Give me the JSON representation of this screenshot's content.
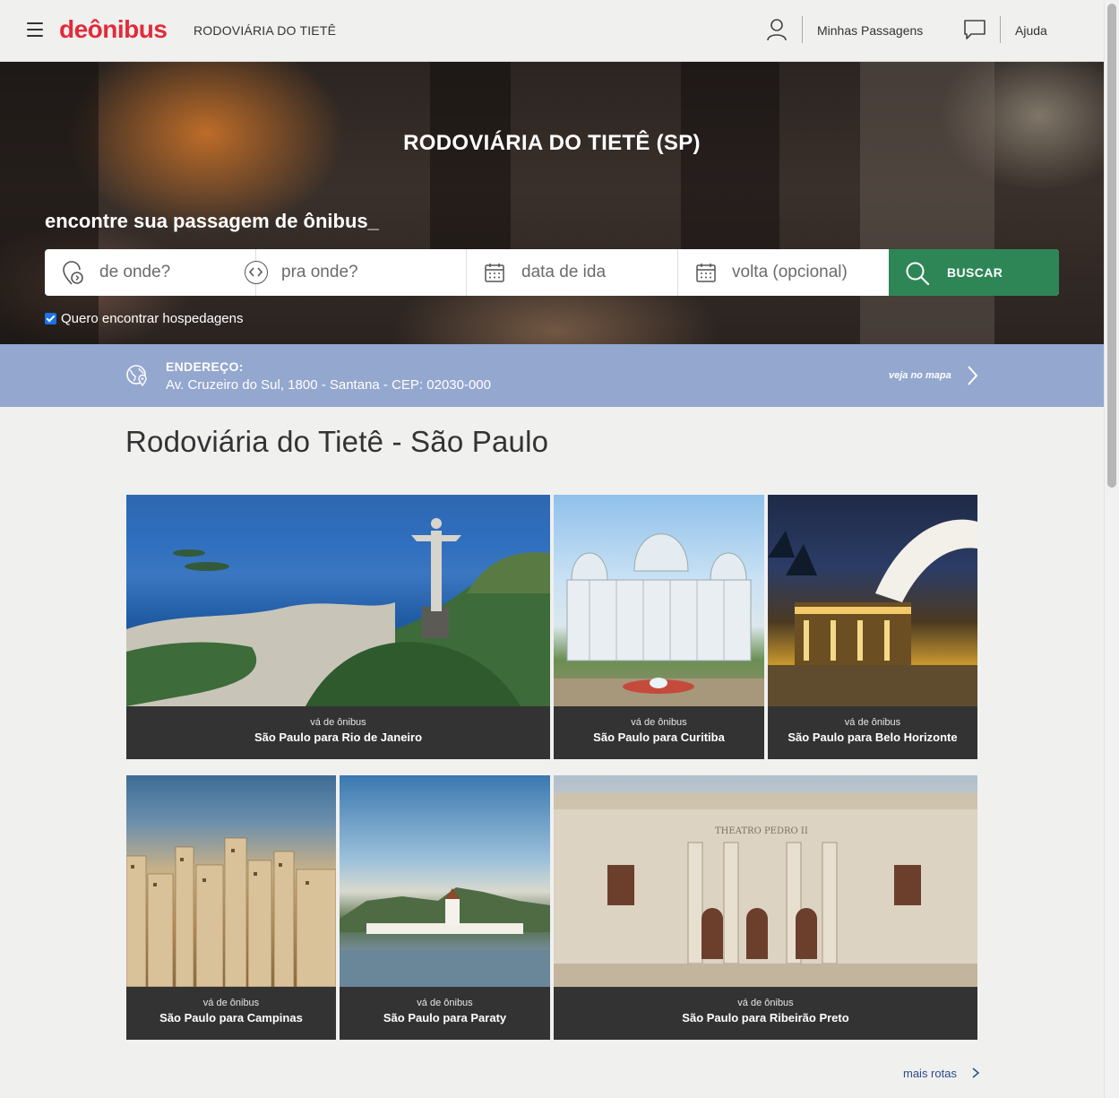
{
  "header": {
    "logo": "deônibus",
    "title": "RODOVIÁRIA DO TIETÊ",
    "my_tickets": "Minhas Passagens",
    "help": "Ajuda"
  },
  "hero": {
    "title": "RODOVIÁRIA DO TIETÊ (SP)",
    "subtitle": "encontre sua passagem de ônibus_",
    "search": {
      "origin_placeholder": "de onde?",
      "destination_placeholder": "pra onde?",
      "departure_placeholder": "data de ida",
      "return_placeholder": "volta (opcional)",
      "search_button": "BUSCAR"
    },
    "lodging_checkbox": {
      "label": "Quero encontrar hospedagens",
      "checked": true
    }
  },
  "address": {
    "label": "ENDEREÇO:",
    "value": "Av. Cruzeiro do Sul, 1800 - Santana - CEP: 02030-000",
    "map_link": "veja no mapa"
  },
  "main": {
    "heading": "Rodoviária do Tietê - São Paulo",
    "routes": [
      {
        "kicker": "vá de ônibus",
        "title": "São Paulo para Rio de Janeiro"
      },
      {
        "kicker": "vá de ônibus",
        "title": "São Paulo para Curitiba"
      },
      {
        "kicker": "vá de ônibus",
        "title": "São Paulo para Belo Horizonte"
      },
      {
        "kicker": "vá de ônibus",
        "title": "São Paulo para Campinas"
      },
      {
        "kicker": "vá de ônibus",
        "title": "São Paulo para Paraty"
      },
      {
        "kicker": "vá de ônibus",
        "title": "São Paulo para Ribeirão Preto"
      }
    ],
    "more_routes": "mais rotas"
  },
  "colors": {
    "brand": "#e22b3a",
    "search_button": "#2e8656",
    "address_bar": "#94a7cf",
    "card_caption": "#333333"
  }
}
